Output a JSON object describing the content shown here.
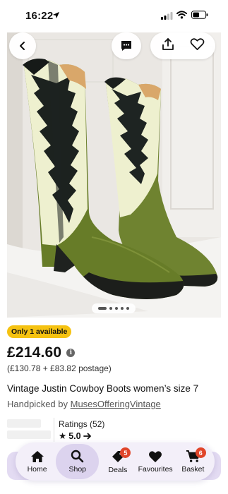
{
  "status_bar": {
    "time": "16:22"
  },
  "listing": {
    "availability_badge": "Only 1 available",
    "price": "£214.60",
    "price_breakdown": "(£130.78 + £83.82 postage)",
    "title": "Vintage Justin Cowboy Boots women’s size 7",
    "seller_prefix": "Handpicked by ",
    "seller_name": "MusesOfferingVintage",
    "ratings_label": "Ratings (52)",
    "ratings_value": "5.0",
    "image_pager": {
      "count": 5,
      "current": 1
    }
  },
  "bottom_nav": {
    "items": [
      {
        "label": "Home",
        "icon": "home-icon"
      },
      {
        "label": "Shop",
        "icon": "search-icon",
        "active": true
      },
      {
        "label": "Deals",
        "icon": "tag-icon",
        "badge": "5"
      },
      {
        "label": "Favourites",
        "icon": "heart-icon"
      },
      {
        "label": "Basket",
        "icon": "basket-icon",
        "badge": "6"
      }
    ]
  },
  "colors": {
    "badge_yellow": "#f5c211",
    "nav_bg": "#f3eff9",
    "nav_active": "#dcd3ee",
    "count_badge": "#e0452a",
    "boot_green": "#6b7f2c",
    "boot_cream": "#eef0cf"
  }
}
